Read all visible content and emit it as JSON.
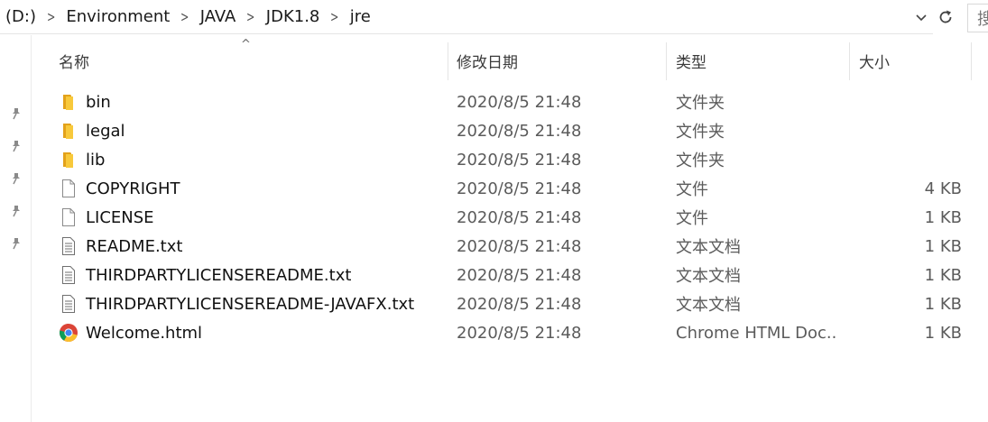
{
  "address": {
    "breadcrumbs": [
      "(D:)",
      "Environment",
      "JAVA",
      "JDK1.8",
      "jre"
    ],
    "search_placeholder": "搜"
  },
  "columns": {
    "name": "名称",
    "date": "修改日期",
    "type": "类型",
    "size": "大小"
  },
  "files": [
    {
      "name": "bin",
      "date": "2020/8/5 21:48",
      "type": "文件夹",
      "size": "",
      "icon": "folder-icon"
    },
    {
      "name": "legal",
      "date": "2020/8/5 21:48",
      "type": "文件夹",
      "size": "",
      "icon": "folder-icon"
    },
    {
      "name": "lib",
      "date": "2020/8/5 21:48",
      "type": "文件夹",
      "size": "",
      "icon": "folder-icon"
    },
    {
      "name": "COPYRIGHT",
      "date": "2020/8/5 21:48",
      "type": "文件",
      "size": "4 KB",
      "icon": "blank-file-icon"
    },
    {
      "name": "LICENSE",
      "date": "2020/8/5 21:48",
      "type": "文件",
      "size": "1 KB",
      "icon": "blank-file-icon"
    },
    {
      "name": "README.txt",
      "date": "2020/8/5 21:48",
      "type": "文本文档",
      "size": "1 KB",
      "icon": "text-file-icon"
    },
    {
      "name": "THIRDPARTYLICENSEREADME.txt",
      "date": "2020/8/5 21:48",
      "type": "文本文档",
      "size": "1 KB",
      "icon": "text-file-icon"
    },
    {
      "name": "THIRDPARTYLICENSEREADME-JAVAFX.txt",
      "date": "2020/8/5 21:48",
      "type": "文本文档",
      "size": "1 KB",
      "icon": "text-file-icon"
    },
    {
      "name": "Welcome.html",
      "date": "2020/8/5 21:48",
      "type": "Chrome HTML Doc...",
      "size": "1 KB",
      "icon": "chrome-icon"
    }
  ],
  "colors": {
    "folder": "#f8c93b",
    "folder_dark": "#e3a21a",
    "text": "#111111",
    "meta_text": "#5b5b5b"
  }
}
